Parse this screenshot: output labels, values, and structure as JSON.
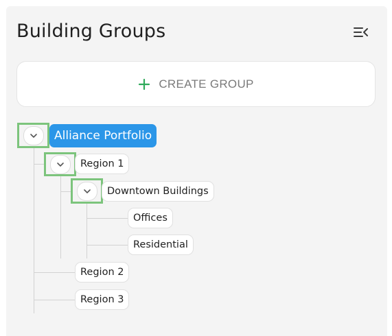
{
  "header": {
    "title": "Building Groups",
    "collapse_icon": "collapse-menu-icon"
  },
  "create_group": {
    "label": "CREATE GROUP",
    "icon": "plus-icon",
    "icon_color": "#2faa5a"
  },
  "tree": {
    "root": {
      "label": "Alliance Portfolio",
      "selected": true,
      "expanded": true
    },
    "region_1": {
      "label": "Region 1",
      "expanded": true
    },
    "downtown": {
      "label": "Downtown Buildings",
      "expanded": true
    },
    "offices": {
      "label": "Offices"
    },
    "residential": {
      "label": "Residential"
    },
    "region_2": {
      "label": "Region 2"
    },
    "region_3": {
      "label": "Region 3"
    }
  },
  "colors": {
    "selected_bg": "#2b96e8",
    "expand_highlight": "#7cc47c"
  }
}
